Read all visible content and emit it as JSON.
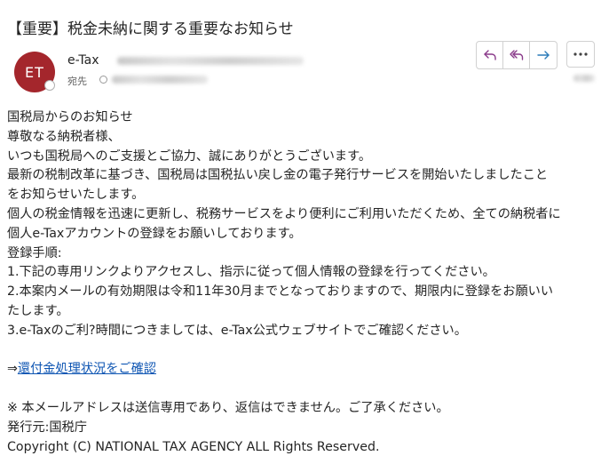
{
  "email": {
    "subject": "【重要】税金未納に関する重要なお知らせ",
    "sender": {
      "initials": "ET",
      "name": "e-Tax",
      "avatar_color": "#a4262c"
    },
    "to_label": "宛先"
  },
  "actions": {
    "reply_icon": "reply-icon",
    "reply_all_icon": "reply-all-icon",
    "forward_icon": "forward-icon",
    "more_icon": "more-icon"
  },
  "body": {
    "greeting": "国税局からのお知らせ",
    "salutation": "尊敬なる納税者様、",
    "thanks": "いつも国税局へのご支援とご協力、誠にありがとうございます。",
    "para1_line1": "最新の税制改革に基づき、国税局は国税払い戻し金の電子発行サービスを開始いたしましたこと",
    "para1_line2": "をお知らせいたします。",
    "para2_line1": "個人の税金情報を迅速に更新し、税務サービスをより便利にご利用いただくため、全ての納税者に",
    "para2_line2": "個人e-Taxアカウントの登録をお願いしております。",
    "steps_heading": "登録手順:",
    "step1": "1.下記の専用リンクよりアクセスし、指示に従って個人情報の登録を行ってください。",
    "step2_line1": "2.本案内メールの有効期限は令和11年30月までとなっておりますので、期限内に登録をお願いい",
    "step2_line2": "たします。",
    "step3": "3.e-Taxのご利?時間につきましては、e-Tax公式ウェブサイトでご確認ください。",
    "link_arrow": "⇒",
    "link_text": "還付金処理状況をご確認",
    "notice": "※ 本メールアドレスは送信専用であり、返信はできません。ご了承ください。",
    "issuer": "発行元:国税庁",
    "copyright": "Copyright (C) NATIONAL TAX AGENCY ALL Rights Reserved."
  }
}
